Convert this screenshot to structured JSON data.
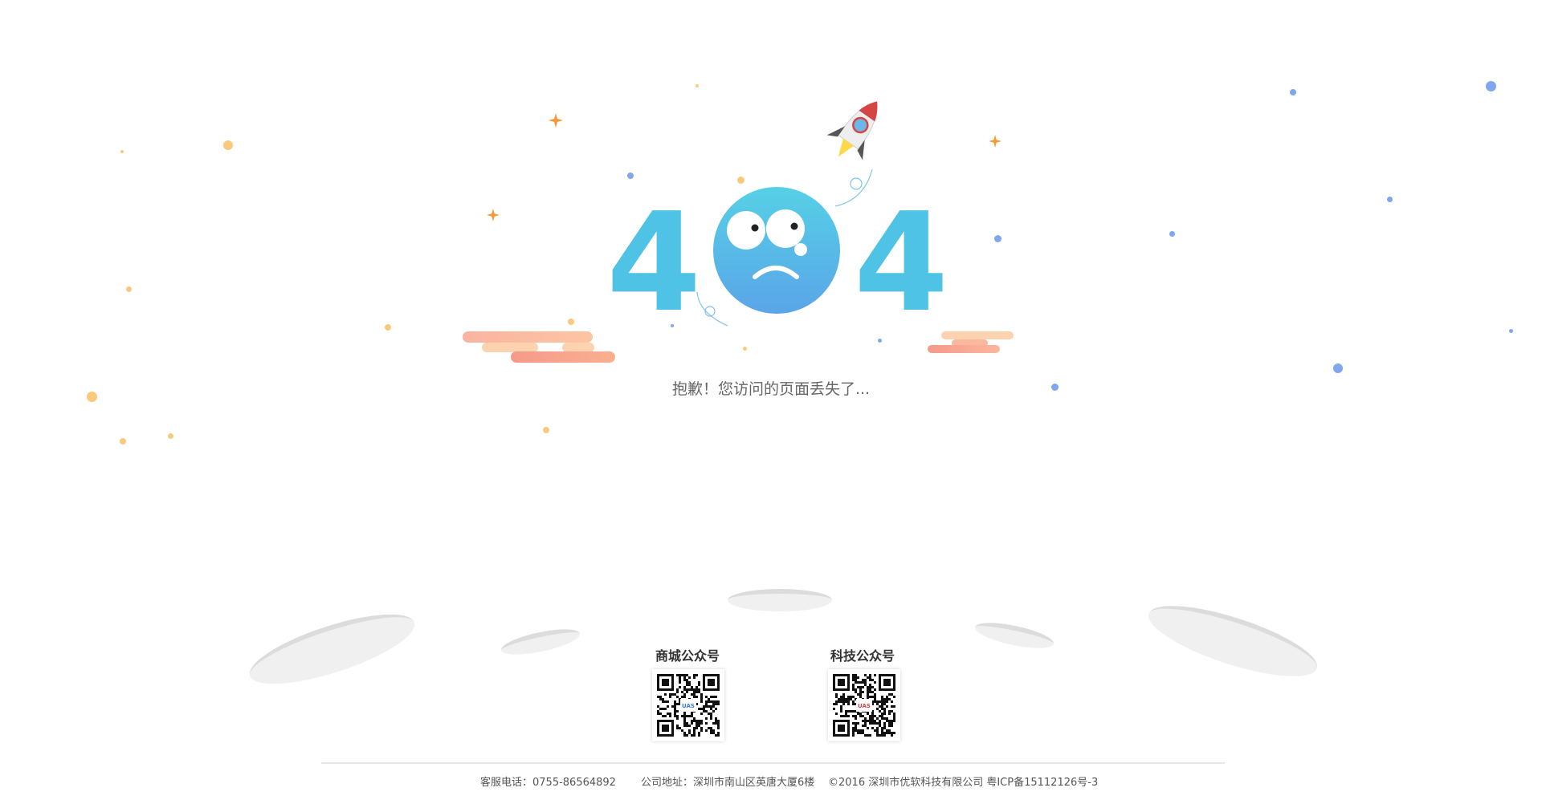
{
  "error": {
    "code_left": "4",
    "code_right": "4",
    "message": "抱歉！您访问的页面丢失了..."
  },
  "qr_codes": [
    {
      "title": "商城公众号",
      "logo_text": "UAS"
    },
    {
      "title": "科技公众号",
      "logo_text": "UAS"
    }
  ],
  "footer": {
    "phone": "客服电话：0755-86564892",
    "address": "公司地址：深圳市南山区英唐大厦6楼",
    "copyright": "©2016 深圳市优软科技有限公司 粤ICP备15112126号-3"
  },
  "colors": {
    "digit_blue": "#4ec3e6",
    "face_top": "#55d0e6",
    "face_bottom": "#5aa5e8",
    "orange_dot": "#fbc97e",
    "blue_dot": "#7ea7ee",
    "cloud_pink": "#f7a58f"
  }
}
